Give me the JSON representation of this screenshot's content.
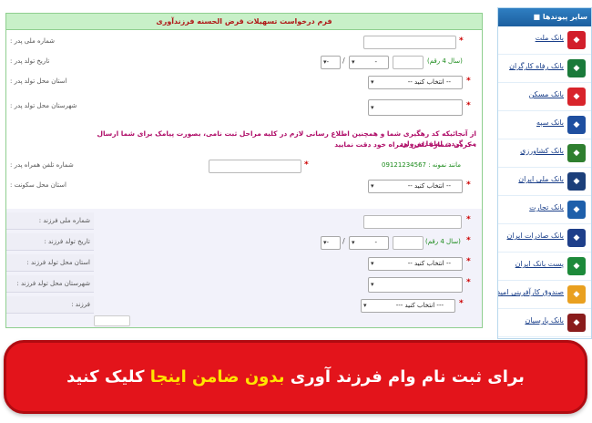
{
  "form": {
    "title": "فرم درخواست تسهیلات قرض الحسنه فرزندآوری",
    "fields": {
      "father_national_id": "شماره ملی پدر :",
      "father_birth_date": "تاریخ تولد پدر :",
      "father_birth_province": "استان محل تولد پدر :",
      "father_birth_city": "شهرستان محل تولد پدر :",
      "father_phone": "شماره تلفن همراه پدر :",
      "residence_province": "استان محل سکونت :",
      "child_national_id": "شماره ملی فرزند :",
      "child_birth_date": "تاریخ تولد فرزند :",
      "child_birth_province": "استان محل تولد فرزند :",
      "child_birth_city": "شهرستان محل تولد فرزند :",
      "child": "فرزند :"
    },
    "year_hint": "(سال 4 رقم)",
    "select_placeholder": "-- انتخاب کنید --",
    "select_placeholder_2": "--- انتخاب کنید ---",
    "date_placeholder": "-",
    "notice_line1": "از آنجائیکه کد رهگیری شما و همچنین اطلاع رسانی لازم در کلیه مراحل ثبت نامی، بصورت پیامک برای شما ارسال می گردد، لطفا در وارد",
    "notice_line2": ". کردن شماره تلفن همراه خود دقت نمایید",
    "sample_phone": "مانند نمونه : 09121234567"
  },
  "sidebar": {
    "title": "سایر پیوندها",
    "items": [
      {
        "label": "بانک ملت",
        "color": "#d21f2b",
        "icon": "mellat-logo-icon"
      },
      {
        "label": "بانک رفاه کارگران",
        "color": "#1a7a3a",
        "icon": "refah-logo-icon"
      },
      {
        "label": "بانک مسکن",
        "color": "#d8242b",
        "icon": "maskan-logo-icon"
      },
      {
        "label": "بانک سپه",
        "color": "#1f4fa0",
        "icon": "sepah-logo-icon"
      },
      {
        "label": "بانک کشاورزی",
        "color": "#2f7f2f",
        "icon": "keshavarzi-logo-icon"
      },
      {
        "label": "بانک ملی ایران",
        "color": "#1c3f7a",
        "icon": "melli-logo-icon"
      },
      {
        "label": "بانک تجارت",
        "color": "#1e5faa",
        "icon": "tejarat-logo-icon"
      },
      {
        "label": "بانک صادرات ایران",
        "color": "#1f3f8a",
        "icon": "saderat-logo-icon"
      },
      {
        "label": "پست بانک ایران",
        "color": "#1d8a3a",
        "icon": "postbank-logo-icon"
      },
      {
        "label": "صندوق کارآفرینی امید",
        "color": "#e9a020",
        "icon": "omid-logo-icon"
      },
      {
        "label": "بانک پارسیان",
        "color": "#8a1c1c",
        "icon": "parsian-logo-icon"
      }
    ]
  },
  "banner": {
    "text_before": "برای ثبت نام وام فرزند آوری ",
    "text_highlight": "بدون ضامن اینجا",
    "text_after": " کلیک کنید",
    "bg_color": "#e3141b",
    "highlight_color": "#ffe500"
  }
}
